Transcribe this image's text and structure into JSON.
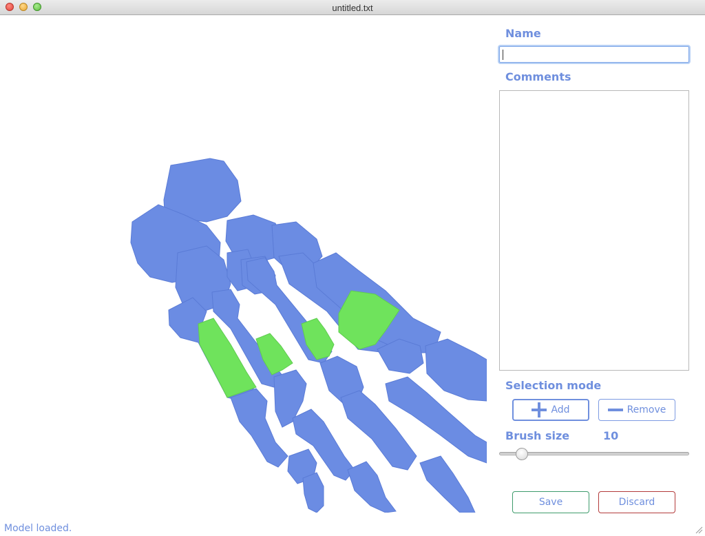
{
  "window": {
    "title": "untitled.txt"
  },
  "panel": {
    "name_label": "Name",
    "name_value": "",
    "comments_label": "Comments",
    "comments_value": "",
    "selection_mode_label": "Selection mode",
    "add_label": "Add",
    "remove_label": "Remove",
    "brush_size_label": "Brush size",
    "brush_size_value": "10",
    "save_label": "Save",
    "discard_label": "Discard"
  },
  "status": {
    "message": "Model loaded."
  },
  "colors": {
    "bone": "#6b8ce3",
    "bone_shadow": "#5273c9",
    "selection": "#6fe35c",
    "accent_text": "#6f8fde",
    "save_border": "#3d9b6b",
    "discard_border": "#b33a3a"
  },
  "icons": {
    "add": "plus-icon",
    "remove": "minus-icon"
  }
}
